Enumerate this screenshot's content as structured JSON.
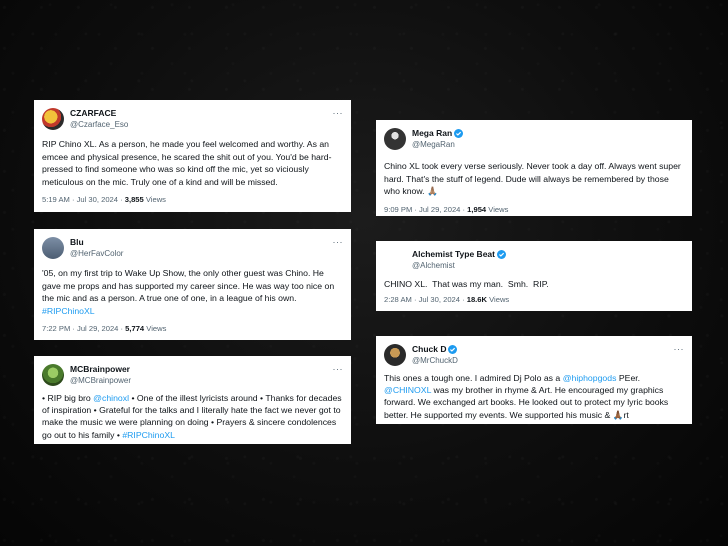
{
  "tweets": [
    {
      "name": "CZARFACE",
      "handle": "@Czarface_Eso",
      "body": "RIP Chino XL. As a person, he made you feel welcomed and worthy. As an emcee and physical presence, he scared the shit out of you. You'd be hard-pressed to find someone who was so kind off the mic, yet so viciously meticulous on the mic. Truly one of a kind and will be missed.",
      "time": "5:19 AM · Jul 30, 2024 · ",
      "views": "3,855",
      "views_label": " Views"
    },
    {
      "name": "Blu",
      "handle": "@HerFavColor",
      "body": "'05, on my first trip to Wake Up Show, the only other guest was Chino. He gave me props and has supported my career since. He was way too nice on the mic and as a person. A true one of one, in a league of his own.",
      "hashtag": "#RIPChinoXL",
      "time": "7:22 PM · Jul 29, 2024 · ",
      "views": "5,774",
      "views_label": " Views"
    },
    {
      "name": "MCBrainpower",
      "handle": "@MCBrainpower",
      "body_1": "• RIP big bro ",
      "mention": "@chinoxl",
      "body_2": " • One of the illest lyricists around • Thanks for decades of inspiration • Grateful for the talks and I literally hate the fact we never got to make the music we were planning on doing • Prayers & sincere condolences go out to his family • ",
      "hashtag": "#RIPChinoXL"
    },
    {
      "name": "Mega Ran",
      "handle": "@MegaRan",
      "body": "Chino XL took every verse seriously. Never took a day off. Always went super hard. That's the stuff of legend. Dude will always be remembered by those who know. 🙏🏽",
      "time": "9:09 PM · Jul 29, 2024 · ",
      "views": "1,954",
      "views_label": " Views"
    },
    {
      "name": "Alchemist Type Beat",
      "handle": "@Alchemist",
      "body": "CHINO XL.  That was my man.  Smh.  RIP.",
      "time": "2:28 AM · Jul 30, 2024 · ",
      "views": "18.6K",
      "views_label": " Views"
    },
    {
      "name": "Chuck D",
      "handle": "@MrChuckD",
      "body_1": "This ones a tough one. I admired Dj Polo as a ",
      "mention_1": "@hiphopgods",
      "body_2": " PEer. ",
      "mention_2": "@CHINOXL",
      "body_3": " was my brother in rhyme & Art. He encouraged my graphics forward. We exchanged art books. He looked out to protect my lyric books better. He supported my events. We supported his music & 🙏🏾rt"
    }
  ],
  "more_glyph": "···",
  "colors": {
    "link": "#1d9bf0",
    "verified": "#1d9bf0",
    "muted": "#536471",
    "text": "#0f1419"
  }
}
